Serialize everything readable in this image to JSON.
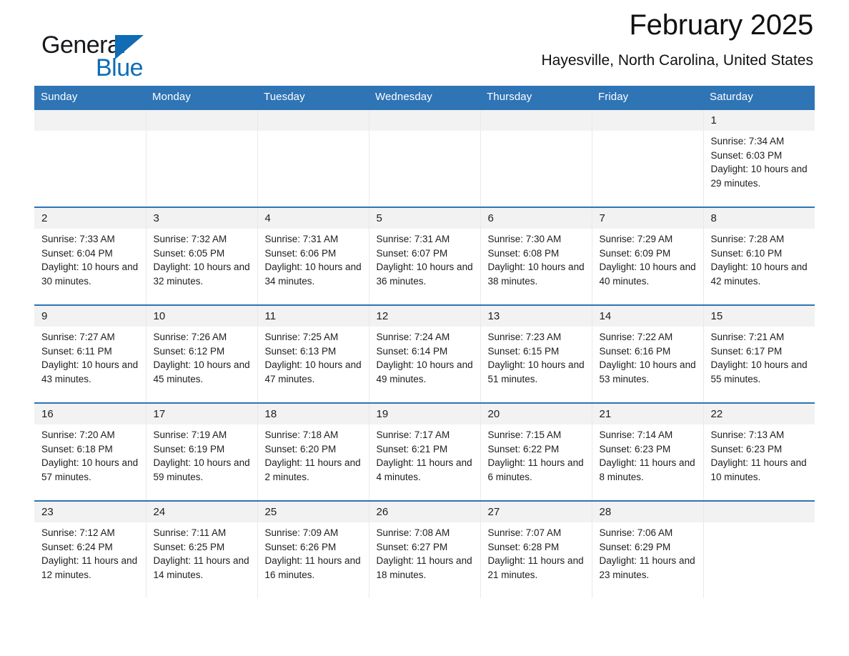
{
  "brand": {
    "name_part1": "General",
    "name_part2": "Blue",
    "triangle_color": "#0f6cb5",
    "icon": "triangle-logo-icon"
  },
  "header": {
    "title": "February 2025",
    "subtitle": "Hayesville, North Carolina, United States"
  },
  "theme": {
    "header_blue": "#2f74b5",
    "row_rule_blue": "#2f74b5",
    "daynum_band": "#f2f2f2",
    "text": "#1d1d1d"
  },
  "weekday_headers": [
    "Sunday",
    "Monday",
    "Tuesday",
    "Wednesday",
    "Thursday",
    "Friday",
    "Saturday"
  ],
  "weeks": [
    [
      {
        "day": "",
        "empty": true
      },
      {
        "day": "",
        "empty": true
      },
      {
        "day": "",
        "empty": true
      },
      {
        "day": "",
        "empty": true
      },
      {
        "day": "",
        "empty": true
      },
      {
        "day": "",
        "empty": true
      },
      {
        "day": "1",
        "sunrise": "Sunrise: 7:34 AM",
        "sunset": "Sunset: 6:03 PM",
        "daylight": "Daylight: 10 hours and 29 minutes."
      }
    ],
    [
      {
        "day": "2",
        "sunrise": "Sunrise: 7:33 AM",
        "sunset": "Sunset: 6:04 PM",
        "daylight": "Daylight: 10 hours and 30 minutes."
      },
      {
        "day": "3",
        "sunrise": "Sunrise: 7:32 AM",
        "sunset": "Sunset: 6:05 PM",
        "daylight": "Daylight: 10 hours and 32 minutes."
      },
      {
        "day": "4",
        "sunrise": "Sunrise: 7:31 AM",
        "sunset": "Sunset: 6:06 PM",
        "daylight": "Daylight: 10 hours and 34 minutes."
      },
      {
        "day": "5",
        "sunrise": "Sunrise: 7:31 AM",
        "sunset": "Sunset: 6:07 PM",
        "daylight": "Daylight: 10 hours and 36 minutes."
      },
      {
        "day": "6",
        "sunrise": "Sunrise: 7:30 AM",
        "sunset": "Sunset: 6:08 PM",
        "daylight": "Daylight: 10 hours and 38 minutes."
      },
      {
        "day": "7",
        "sunrise": "Sunrise: 7:29 AM",
        "sunset": "Sunset: 6:09 PM",
        "daylight": "Daylight: 10 hours and 40 minutes."
      },
      {
        "day": "8",
        "sunrise": "Sunrise: 7:28 AM",
        "sunset": "Sunset: 6:10 PM",
        "daylight": "Daylight: 10 hours and 42 minutes."
      }
    ],
    [
      {
        "day": "9",
        "sunrise": "Sunrise: 7:27 AM",
        "sunset": "Sunset: 6:11 PM",
        "daylight": "Daylight: 10 hours and 43 minutes."
      },
      {
        "day": "10",
        "sunrise": "Sunrise: 7:26 AM",
        "sunset": "Sunset: 6:12 PM",
        "daylight": "Daylight: 10 hours and 45 minutes."
      },
      {
        "day": "11",
        "sunrise": "Sunrise: 7:25 AM",
        "sunset": "Sunset: 6:13 PM",
        "daylight": "Daylight: 10 hours and 47 minutes."
      },
      {
        "day": "12",
        "sunrise": "Sunrise: 7:24 AM",
        "sunset": "Sunset: 6:14 PM",
        "daylight": "Daylight: 10 hours and 49 minutes."
      },
      {
        "day": "13",
        "sunrise": "Sunrise: 7:23 AM",
        "sunset": "Sunset: 6:15 PM",
        "daylight": "Daylight: 10 hours and 51 minutes."
      },
      {
        "day": "14",
        "sunrise": "Sunrise: 7:22 AM",
        "sunset": "Sunset: 6:16 PM",
        "daylight": "Daylight: 10 hours and 53 minutes."
      },
      {
        "day": "15",
        "sunrise": "Sunrise: 7:21 AM",
        "sunset": "Sunset: 6:17 PM",
        "daylight": "Daylight: 10 hours and 55 minutes."
      }
    ],
    [
      {
        "day": "16",
        "sunrise": "Sunrise: 7:20 AM",
        "sunset": "Sunset: 6:18 PM",
        "daylight": "Daylight: 10 hours and 57 minutes."
      },
      {
        "day": "17",
        "sunrise": "Sunrise: 7:19 AM",
        "sunset": "Sunset: 6:19 PM",
        "daylight": "Daylight: 10 hours and 59 minutes."
      },
      {
        "day": "18",
        "sunrise": "Sunrise: 7:18 AM",
        "sunset": "Sunset: 6:20 PM",
        "daylight": "Daylight: 11 hours and 2 minutes."
      },
      {
        "day": "19",
        "sunrise": "Sunrise: 7:17 AM",
        "sunset": "Sunset: 6:21 PM",
        "daylight": "Daylight: 11 hours and 4 minutes."
      },
      {
        "day": "20",
        "sunrise": "Sunrise: 7:15 AM",
        "sunset": "Sunset: 6:22 PM",
        "daylight": "Daylight: 11 hours and 6 minutes."
      },
      {
        "day": "21",
        "sunrise": "Sunrise: 7:14 AM",
        "sunset": "Sunset: 6:23 PM",
        "daylight": "Daylight: 11 hours and 8 minutes."
      },
      {
        "day": "22",
        "sunrise": "Sunrise: 7:13 AM",
        "sunset": "Sunset: 6:23 PM",
        "daylight": "Daylight: 11 hours and 10 minutes."
      }
    ],
    [
      {
        "day": "23",
        "sunrise": "Sunrise: 7:12 AM",
        "sunset": "Sunset: 6:24 PM",
        "daylight": "Daylight: 11 hours and 12 minutes."
      },
      {
        "day": "24",
        "sunrise": "Sunrise: 7:11 AM",
        "sunset": "Sunset: 6:25 PM",
        "daylight": "Daylight: 11 hours and 14 minutes."
      },
      {
        "day": "25",
        "sunrise": "Sunrise: 7:09 AM",
        "sunset": "Sunset: 6:26 PM",
        "daylight": "Daylight: 11 hours and 16 minutes."
      },
      {
        "day": "26",
        "sunrise": "Sunrise: 7:08 AM",
        "sunset": "Sunset: 6:27 PM",
        "daylight": "Daylight: 11 hours and 18 minutes."
      },
      {
        "day": "27",
        "sunrise": "Sunrise: 7:07 AM",
        "sunset": "Sunset: 6:28 PM",
        "daylight": "Daylight: 11 hours and 21 minutes."
      },
      {
        "day": "28",
        "sunrise": "Sunrise: 7:06 AM",
        "sunset": "Sunset: 6:29 PM",
        "daylight": "Daylight: 11 hours and 23 minutes."
      },
      {
        "day": "",
        "empty": true
      }
    ]
  ]
}
